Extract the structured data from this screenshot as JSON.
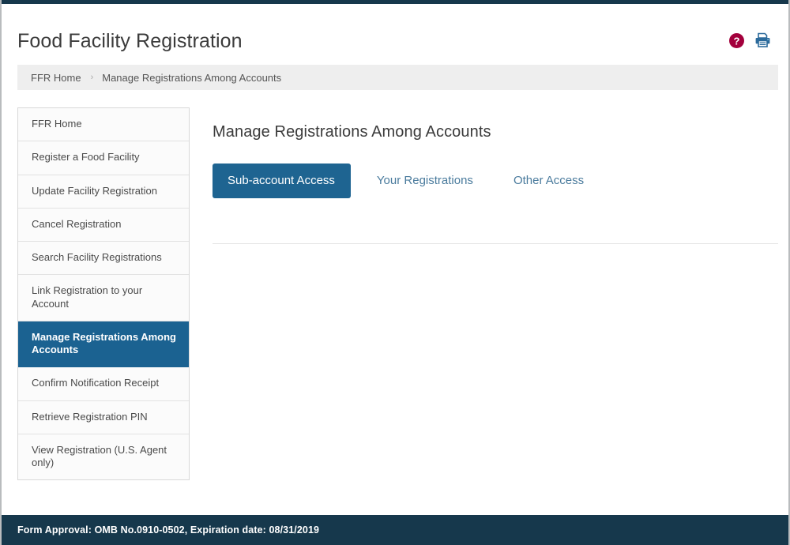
{
  "app": {
    "title": "Food Facility Registration",
    "accent_blue": "#1b6291",
    "tab_blue": "#1e6491",
    "link_blue": "#4a7b9d",
    "footer_navy": "#16384c",
    "help_icon_red": "#a3003c",
    "printer_icon_blue": "#2b6a9b"
  },
  "header": {
    "title": "Food Facility Registration",
    "help_icon": "help-circle-icon",
    "print_icon": "printer-icon"
  },
  "breadcrumb": {
    "home_label": "FFR Home",
    "separator": "›",
    "current_label": "Manage Registrations Among Accounts"
  },
  "sidebar": {
    "items": [
      {
        "label": "FFR Home",
        "active": false
      },
      {
        "label": "Register a Food Facility",
        "active": false
      },
      {
        "label": "Update Facility Registration",
        "active": false
      },
      {
        "label": "Cancel Registration",
        "active": false
      },
      {
        "label": "Search Facility Registrations",
        "active": false
      },
      {
        "label": "Link Registration to your Account",
        "active": false
      },
      {
        "label": "Manage Registrations Among Accounts",
        "active": true
      },
      {
        "label": "Confirm Notification Receipt",
        "active": false
      },
      {
        "label": "Retrieve Registration PIN",
        "active": false
      },
      {
        "label": "View Registration (U.S. Agent only)",
        "active": false
      }
    ]
  },
  "main": {
    "title": "Manage Registrations Among Accounts",
    "tabs": [
      {
        "label": "Sub-account Access",
        "active": true
      },
      {
        "label": "Your Registrations",
        "active": false
      },
      {
        "label": "Other Access",
        "active": false
      }
    ],
    "panel_content": ""
  },
  "footer": {
    "text": "Form Approval: OMB No.0910-0502, Expiration date: 08/31/2019"
  }
}
